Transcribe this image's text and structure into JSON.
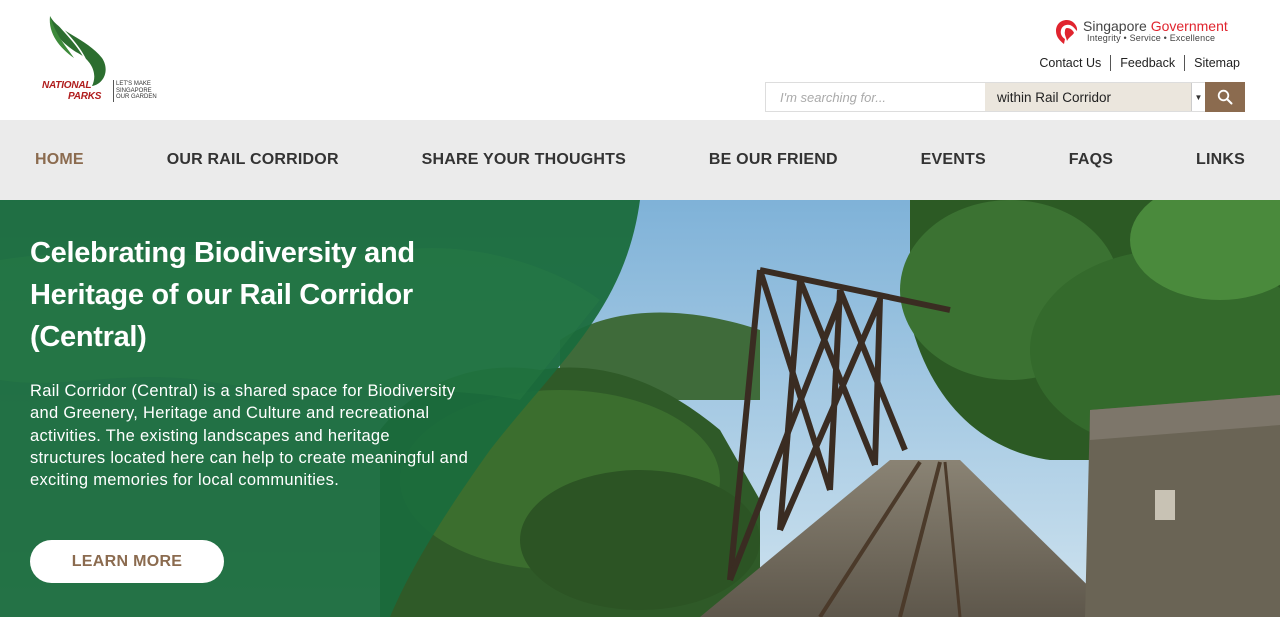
{
  "logo": {
    "line1": "NATIONAL",
    "line2": "PARKS",
    "tagline": "LET'S MAKE SINGAPORE OUR GARDEN",
    "leaf_color": "#2c6e2f",
    "text_color": "#b01c1c"
  },
  "gov_brand": {
    "name_part1": "Singapore",
    "name_part2": "Government",
    "motto": "Integrity • Service • Excellence",
    "accent_color": "#e0242e",
    "icon": "lion-head-icon"
  },
  "util_links": {
    "contact": "Contact Us",
    "feedback": "Feedback",
    "sitemap": "Sitemap"
  },
  "search": {
    "placeholder": "I'm searching for...",
    "value": "",
    "scope": "within Rail Corridor",
    "button_icon": "search-icon"
  },
  "nav": {
    "home": "HOME",
    "rail": "OUR RAIL CORRIDOR",
    "thoughts": "SHARE YOUR THOUGHTS",
    "friend": "BE OUR FRIEND",
    "events": "EVENTS",
    "faqs": "FAQS",
    "links": "LINKS",
    "active_color": "#8b6b4f"
  },
  "hero": {
    "title": "Celebrating Biodiversity and Heritage of our Rail Corridor (Central)",
    "description": "Rail Corridor (Central) is a shared space for Biodiversity and Greenery, Heritage and Culture and recreational activities. The existing landscapes and heritage structures located here can help to create meaningful and exciting memories for local communities.",
    "cta": "LEARN MORE",
    "overlay_color": "#1a6b3c",
    "brand_brown": "#8b6b4f"
  }
}
